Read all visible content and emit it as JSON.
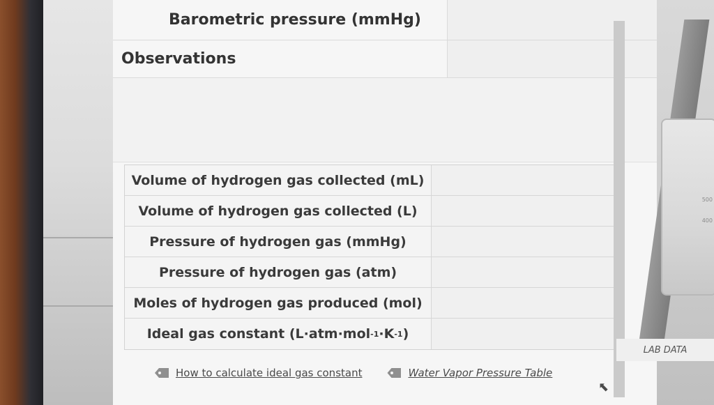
{
  "form": {
    "barometric_label": "Barometric pressure (mmHg)",
    "observations_label": "Observations"
  },
  "data_table": {
    "rows": [
      {
        "label": "Volume of hydrogen gas collected (mL)"
      },
      {
        "label": "Volume of hydrogen gas collected (L)"
      },
      {
        "label": "Pressure of hydrogen gas (mmHg)"
      },
      {
        "label": "Pressure of hydrogen gas (atm)"
      },
      {
        "label": "Moles of hydrogen gas produced (mol)"
      },
      {
        "label_prefix": "Ideal gas constant (L·atm·mol",
        "label_exp1": "-1",
        "label_mid": "·K",
        "label_exp2": "-1",
        "label_suffix": ")"
      }
    ]
  },
  "links": {
    "ideal_gas": "How to calculate ideal gas constant",
    "vapor_table": "Water Vapor Pressure Table"
  },
  "lab_panel": {
    "tab_label": "LAB DATA",
    "beaker_marks": [
      "500",
      "400"
    ]
  },
  "icons": {
    "tag": "tag-icon",
    "cursor": "cursor-icon"
  },
  "colors": {
    "text": "#333333",
    "panel": "#f6f6f6"
  }
}
